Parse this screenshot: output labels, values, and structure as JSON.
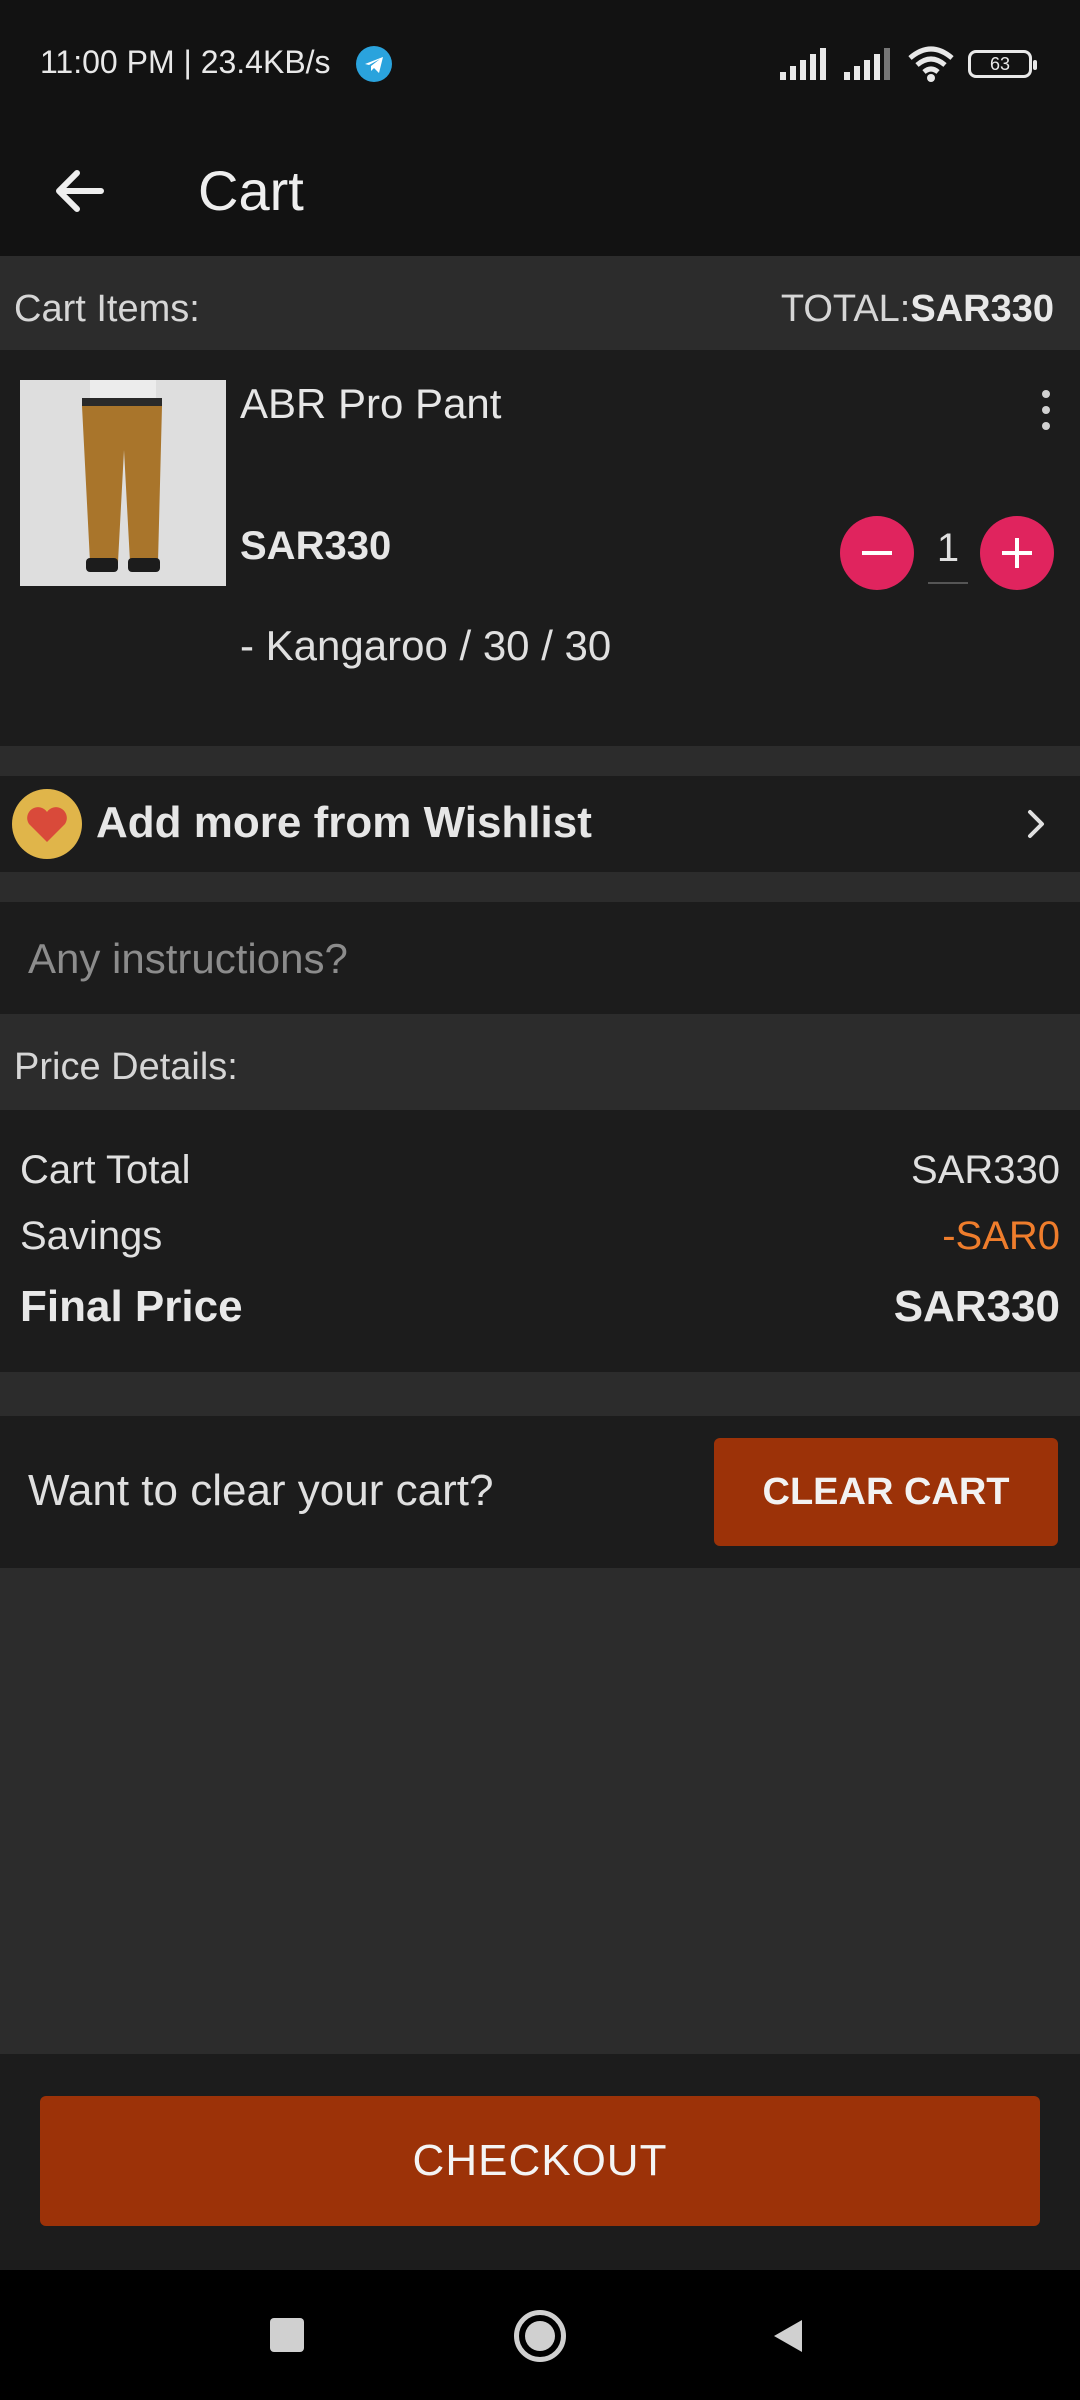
{
  "status_bar": {
    "time_speed": "11:00 PM | 23.4KB/s",
    "battery": "63"
  },
  "app_bar": {
    "title": "Cart"
  },
  "cart_header": {
    "items_label": "Cart Items:",
    "total_prefix": "TOTAL:",
    "total_value": "SAR330"
  },
  "item": {
    "name": "ABR Pro Pant",
    "price": "SAR330",
    "quantity": "1",
    "variant": "- Kangaroo / 30 / 30",
    "product_color": "#a9752b"
  },
  "wishlist": {
    "label": "Add more from Wishlist"
  },
  "instructions": {
    "placeholder": "Any instructions?"
  },
  "price_details": {
    "label": "Price Details:",
    "cart_total_label": "Cart Total",
    "cart_total_value": "SAR330",
    "savings_label": "Savings",
    "savings_value": "-SAR0",
    "final_label": "Final Price",
    "final_value": "SAR330"
  },
  "clear_cart": {
    "prompt": "Want to clear your cart?",
    "button": "CLEAR CART"
  },
  "checkout": {
    "button": "CHECKOUT"
  },
  "colors": {
    "accent_button": "#9c3208",
    "qty_button": "#e0245e",
    "savings": "#ef7d2c"
  }
}
